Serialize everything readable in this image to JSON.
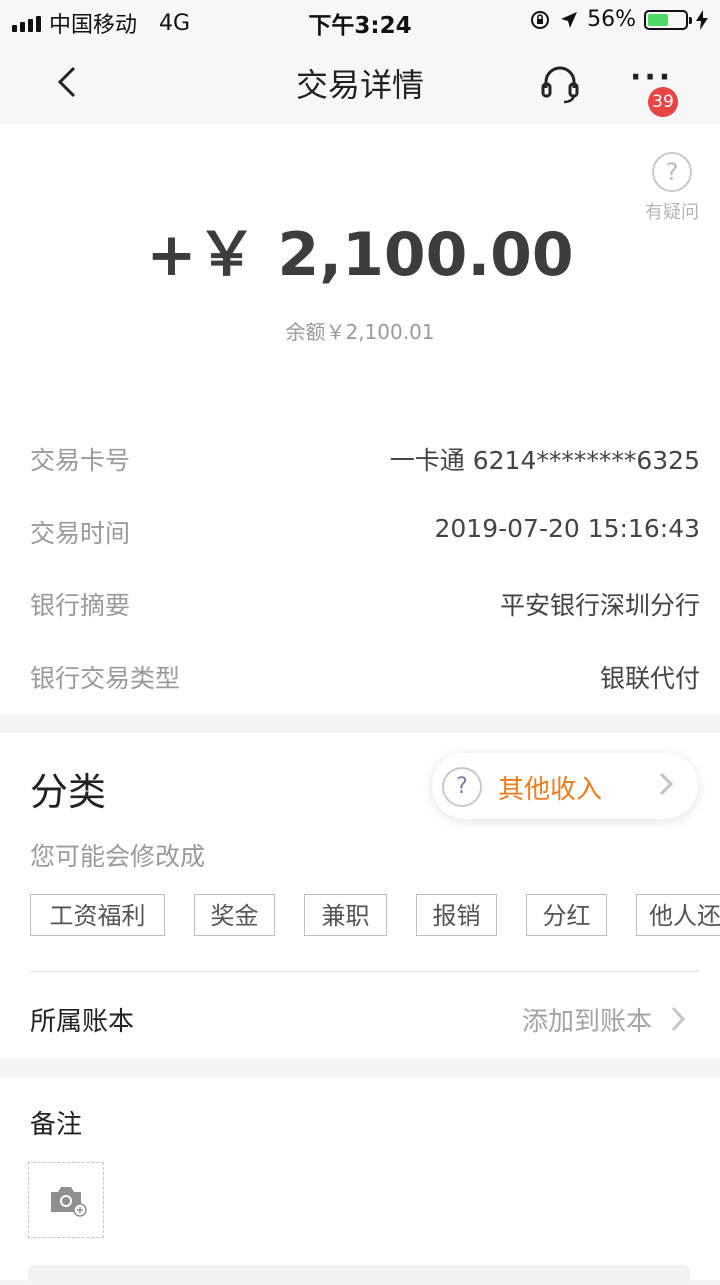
{
  "status_bar": {
    "carrier": "中国移动",
    "network": "4G",
    "time": "下午3:24",
    "battery": "56%",
    "battery_level": 0.56
  },
  "nav": {
    "title": "交易详情",
    "notification_count": "39"
  },
  "help": {
    "label": "有疑问"
  },
  "amount": "+￥ 2,100.00",
  "balance": "余额￥2,100.01",
  "details": [
    {
      "key": "交易卡号",
      "value": "一卡通 6214********6325"
    },
    {
      "key": "交易时间",
      "value": "2019-07-20 15:16:43"
    },
    {
      "key": "银行摘要",
      "value": "平安银行深圳分行"
    },
    {
      "key": "银行交易类型",
      "value": "银联代付"
    }
  ],
  "category": {
    "title": "分类",
    "current": "其他收入",
    "suggest_label": "您可能会修改成",
    "options": [
      "工资福利",
      "奖金",
      "兼职",
      "报销",
      "分红",
      "他人还"
    ]
  },
  "account_book": {
    "label": "所属账本",
    "action": "添加到账本"
  },
  "note": {
    "label": "备注"
  },
  "colors": {
    "accent": "#f07b1d",
    "badge": "#e84545",
    "battery": "#4cd964"
  }
}
